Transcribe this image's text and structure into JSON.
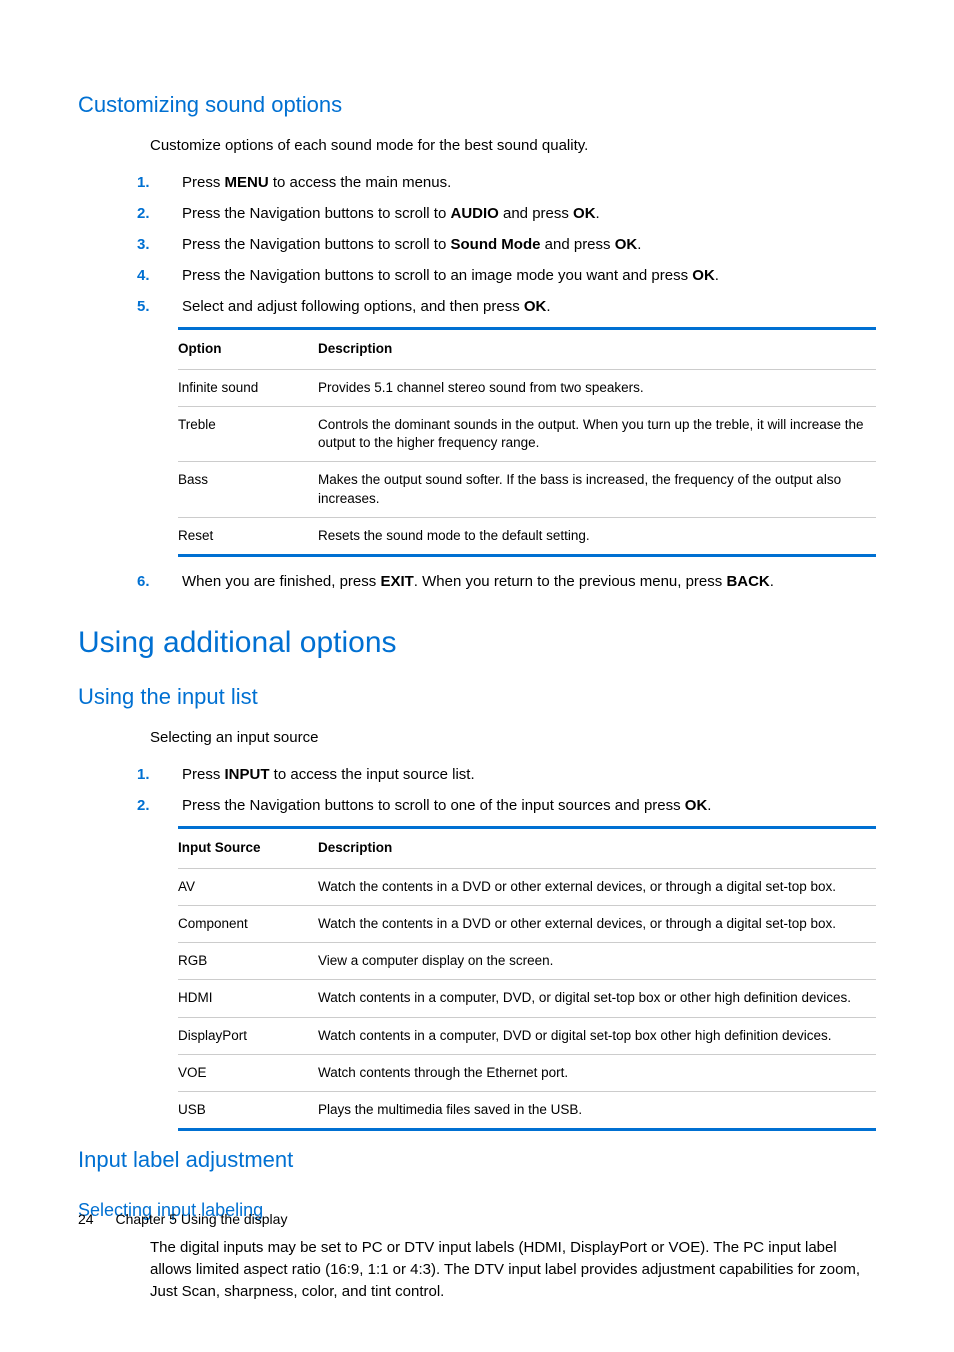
{
  "sections": {
    "customizing": {
      "title": "Customizing sound options",
      "intro": "Customize options of each sound mode for the best sound quality.",
      "steps": [
        {
          "num": "1.",
          "pre": "Press ",
          "b1": "MENU",
          "post": " to access the main menus."
        },
        {
          "num": "2.",
          "pre": "Press the Navigation buttons to scroll to ",
          "b1": "AUDIO",
          "mid": " and press ",
          "b2": "OK",
          "post": "."
        },
        {
          "num": "3.",
          "pre": "Press the Navigation buttons to scroll to ",
          "b1": "Sound Mode",
          "mid": " and press ",
          "b2": "OK",
          "post": "."
        },
        {
          "num": "4.",
          "pre": "Press the Navigation buttons to scroll to an image mode you want and press ",
          "b1": "OK",
          "post": "."
        },
        {
          "num": "5.",
          "pre": "Select and adjust following options, and then press ",
          "b1": "OK",
          "post": "."
        }
      ],
      "table": {
        "headers": [
          "Option",
          "Description"
        ],
        "rows": [
          {
            "opt": "Infinite sound",
            "desc": "Provides 5.1 channel stereo sound from two speakers."
          },
          {
            "opt": "Treble",
            "desc": "Controls the dominant sounds in the output. When you turn up the treble, it will increase the output to the higher frequency range."
          },
          {
            "opt": "Bass",
            "desc": "Makes the output sound softer. If the bass is increased, the frequency of the output also increases."
          },
          {
            "opt": "Reset",
            "desc": "Resets the sound mode to the default setting."
          }
        ]
      },
      "step6": {
        "num": "6.",
        "pre": "When you are finished, press ",
        "b1": "EXIT",
        "mid": ". When you return to the previous menu, press ",
        "b2": "BACK",
        "post": "."
      }
    },
    "additional": {
      "title": "Using additional options"
    },
    "inputlist": {
      "title": "Using the input list",
      "intro": "Selecting an input source",
      "steps": [
        {
          "num": "1.",
          "pre": "Press ",
          "b1": "INPUT",
          "post": " to access the input source list."
        },
        {
          "num": "2.",
          "pre": "Press the Navigation buttons to scroll to one of the input sources and press ",
          "b1": "OK",
          "post": "."
        }
      ],
      "table": {
        "headers": [
          "Input Source",
          "Description"
        ],
        "rows": [
          {
            "opt": "AV",
            "desc": "Watch the contents in a DVD or other external devices, or through a digital set-top box."
          },
          {
            "opt": "Component",
            "desc": "Watch the contents in a DVD or other external devices, or through a digital set-top box."
          },
          {
            "opt": "RGB",
            "desc": "View a computer display on the screen."
          },
          {
            "opt": "HDMI",
            "desc": "Watch contents in a computer, DVD, or digital set-top box or other high definition devices."
          },
          {
            "opt": "DisplayPort",
            "desc": "Watch contents in a computer, DVD or digital set-top box other high definition devices."
          },
          {
            "opt": "VOE",
            "desc": "Watch contents through the Ethernet port."
          },
          {
            "opt": "USB",
            "desc": "Plays the multimedia files saved in the USB."
          }
        ]
      }
    },
    "inputlabel": {
      "title": "Input label adjustment",
      "subtitle": "Selecting input labeling",
      "body": "The digital inputs may be set to PC or DTV input labels (HDMI, DisplayPort or VOE). The PC input label allows limited aspect ratio (16:9, 1:1 or 4:3). The DTV input label provides adjustment capabilities for zoom, Just Scan, sharpness, color, and tint control."
    }
  },
  "footer": {
    "page": "24",
    "chapter": "Chapter 5   Using the display"
  }
}
